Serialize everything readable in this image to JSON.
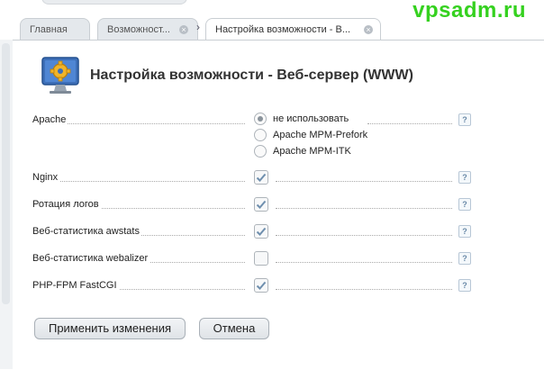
{
  "watermark": "vpsadm.ru",
  "tabs": [
    {
      "label": "Главная"
    },
    {
      "label": "Возможност...",
      "closable": true
    },
    {
      "label": "Настройка возможности - В...",
      "closable": true,
      "active": true
    }
  ],
  "page": {
    "title": "Настройка возможности - Веб-сервер (WWW)"
  },
  "form": {
    "apache": {
      "label": "Apache",
      "options": [
        "не использовать",
        "Apache MPM-Prefork",
        "Apache MPM-ITK"
      ],
      "selected": "не использовать"
    },
    "fields": [
      {
        "label": "Nginx",
        "checked": true
      },
      {
        "label": "Ротация логов",
        "checked": true
      },
      {
        "label": "Веб-статистика awstats",
        "checked": true
      },
      {
        "label": "Веб-статистика webalizer",
        "checked": false
      },
      {
        "label": "PHP-FPM FastCGI",
        "checked": true
      }
    ],
    "help_glyph": "?"
  },
  "buttons": {
    "apply": "Применить изменения",
    "cancel": "Отмена"
  },
  "colors": {
    "watermark": "#35d11f",
    "tab_bg": "#e4e8ec",
    "check": "#6f8fae"
  }
}
